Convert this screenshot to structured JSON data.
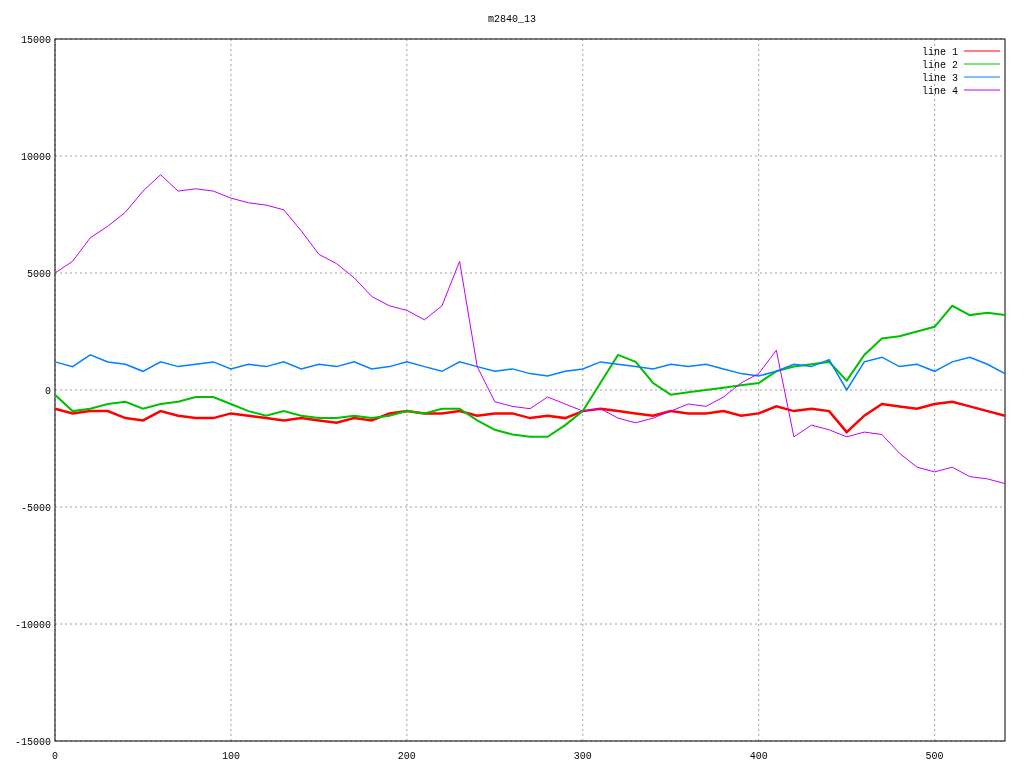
{
  "chart_data": {
    "type": "line",
    "title": "m2840_13",
    "x": [
      0,
      10,
      20,
      30,
      40,
      50,
      60,
      70,
      80,
      90,
      100,
      110,
      120,
      130,
      140,
      150,
      160,
      170,
      180,
      190,
      200,
      210,
      220,
      230,
      240,
      250,
      260,
      270,
      280,
      290,
      300,
      310,
      320,
      330,
      340,
      350,
      360,
      370,
      380,
      390,
      400,
      410,
      420,
      430,
      440,
      450,
      460,
      470,
      480,
      490,
      500,
      510,
      520,
      530,
      540
    ],
    "series": [
      {
        "name": "line 1",
        "color": "#ff0000",
        "values": [
          -800,
          -1000,
          -900,
          -900,
          -1200,
          -1300,
          -900,
          -1100,
          -1200,
          -1200,
          -1000,
          -1100,
          -1200,
          -1300,
          -1200,
          -1300,
          -1400,
          -1200,
          -1300,
          -1000,
          -900,
          -1000,
          -1000,
          -900,
          -1100,
          -1000,
          -1000,
          -1200,
          -1100,
          -1200,
          -900,
          -800,
          -900,
          -1000,
          -1100,
          -900,
          -1000,
          -1000,
          -900,
          -1100,
          -1000,
          -700,
          -900,
          -800,
          -900,
          -1800,
          -1100,
          -600,
          -700,
          -800,
          -600,
          -500,
          -700,
          -900,
          -1100
        ]
      },
      {
        "name": "line 2",
        "color": "#00c000",
        "values": [
          -200,
          -900,
          -800,
          -600,
          -500,
          -800,
          -600,
          -500,
          -300,
          -300,
          -600,
          -900,
          -1100,
          -900,
          -1100,
          -1200,
          -1200,
          -1100,
          -1200,
          -1100,
          -900,
          -1000,
          -800,
          -800,
          -1300,
          -1700,
          -1900,
          -2000,
          -2000,
          -1500,
          -900,
          300,
          1500,
          1200,
          300,
          -200,
          -100,
          0,
          100,
          200,
          300,
          800,
          1000,
          1100,
          1200,
          400,
          1500,
          2200,
          2300,
          2500,
          2700,
          3600,
          3200,
          3300,
          3200
        ]
      },
      {
        "name": "line 3",
        "color": "#0080ff",
        "values": [
          1200,
          1000,
          1500,
          1200,
          1100,
          800,
          1200,
          1000,
          1100,
          1200,
          900,
          1100,
          1000,
          1200,
          900,
          1100,
          1000,
          1200,
          900,
          1000,
          1200,
          1000,
          800,
          1200,
          1000,
          800,
          900,
          700,
          600,
          800,
          900,
          1200,
          1100,
          1000,
          900,
          1100,
          1000,
          1100,
          900,
          700,
          600,
          800,
          1100,
          1000,
          1300,
          0,
          1200,
          1400,
          1000,
          1100,
          800,
          1200,
          1400,
          1100,
          700
        ]
      },
      {
        "name": "line 4",
        "color": "#c000ff",
        "values": [
          5000,
          5500,
          6500,
          7000,
          7600,
          8500,
          9200,
          8500,
          8600,
          8500,
          8200,
          8000,
          7900,
          7700,
          6800,
          5800,
          5400,
          4800,
          4000,
          3600,
          3400,
          3000,
          3600,
          5500,
          1000,
          -500,
          -700,
          -800,
          -300,
          -600,
          -900,
          -800,
          -1200,
          -1400,
          -1200,
          -900,
          -600,
          -700,
          -300,
          300,
          700,
          1700,
          -2000,
          -1500,
          -1700,
          -2000,
          -1800,
          -1900,
          -2700,
          -3300,
          -3500,
          -3300,
          -3700,
          -3800,
          -4000
        ]
      }
    ],
    "xlim": [
      0,
      540
    ],
    "ylim": [
      -15000,
      15000
    ],
    "xticks": [
      0,
      100,
      200,
      300,
      400,
      500
    ],
    "yticks": [
      -15000,
      -10000,
      -5000,
      0,
      5000,
      10000,
      15000
    ],
    "grid": true,
    "legend": true
  }
}
